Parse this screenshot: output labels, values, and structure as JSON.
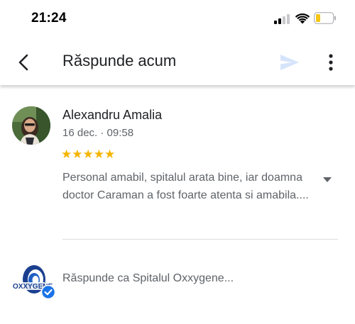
{
  "status_bar": {
    "time": "21:24"
  },
  "app_bar": {
    "title": "Răspunde acum"
  },
  "review": {
    "reviewer_name": "Alexandru Amalia",
    "date": "16 dec. · 09:58",
    "stars_display": "★★★★★",
    "rating": 5,
    "text": "Personal amabil, spitalul arata bine, iar doamna doctor Caraman a fost foarte atenta si amabila...."
  },
  "reply": {
    "placeholder": "Răspunde ca Spitalul Oxxygene...",
    "logo_text": "OXXYGENE"
  },
  "colors": {
    "star": "#f4b400",
    "secondary_text": "#5f6368",
    "send_disabled": "#d6e4fb",
    "verified": "#1a73e8",
    "logo_blue": "#1a3f8f"
  }
}
